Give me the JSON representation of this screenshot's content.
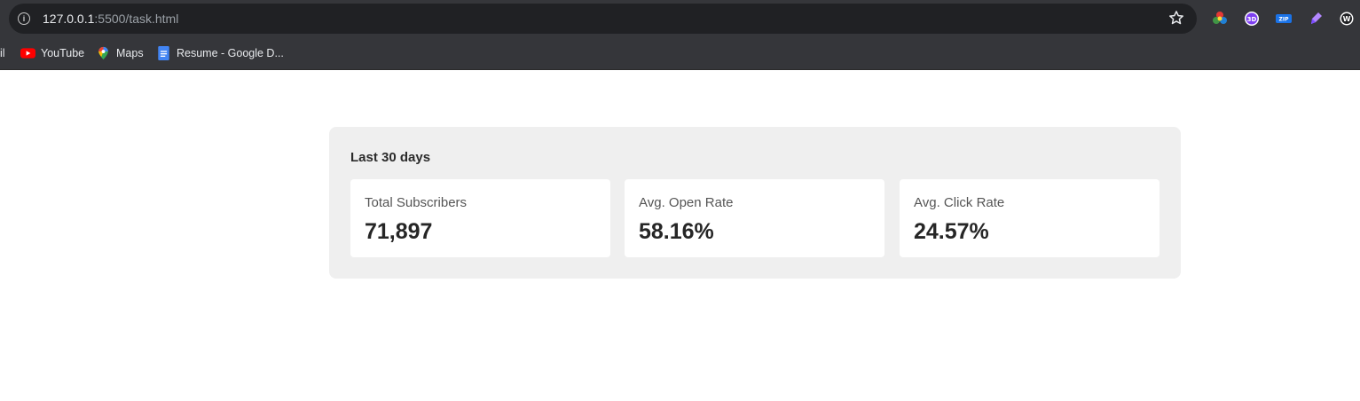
{
  "browser": {
    "url_host": "127.0.0.1",
    "url_rest": ":5500/task.html",
    "bookmarks": [
      {
        "label": "il"
      },
      {
        "label": "YouTube"
      },
      {
        "label": "Maps"
      },
      {
        "label": "Resume - Google D..."
      }
    ],
    "extensions": [
      "color-wheel-icon",
      "3d-icon",
      "zip-icon",
      "pen-icon",
      "w-icon"
    ]
  },
  "panel": {
    "title": "Last 30 days",
    "stats": [
      {
        "label": "Total Subscribers",
        "value": "71,897"
      },
      {
        "label": "Avg. Open Rate",
        "value": "58.16%"
      },
      {
        "label": "Avg. Click Rate",
        "value": "24.57%"
      }
    ]
  }
}
